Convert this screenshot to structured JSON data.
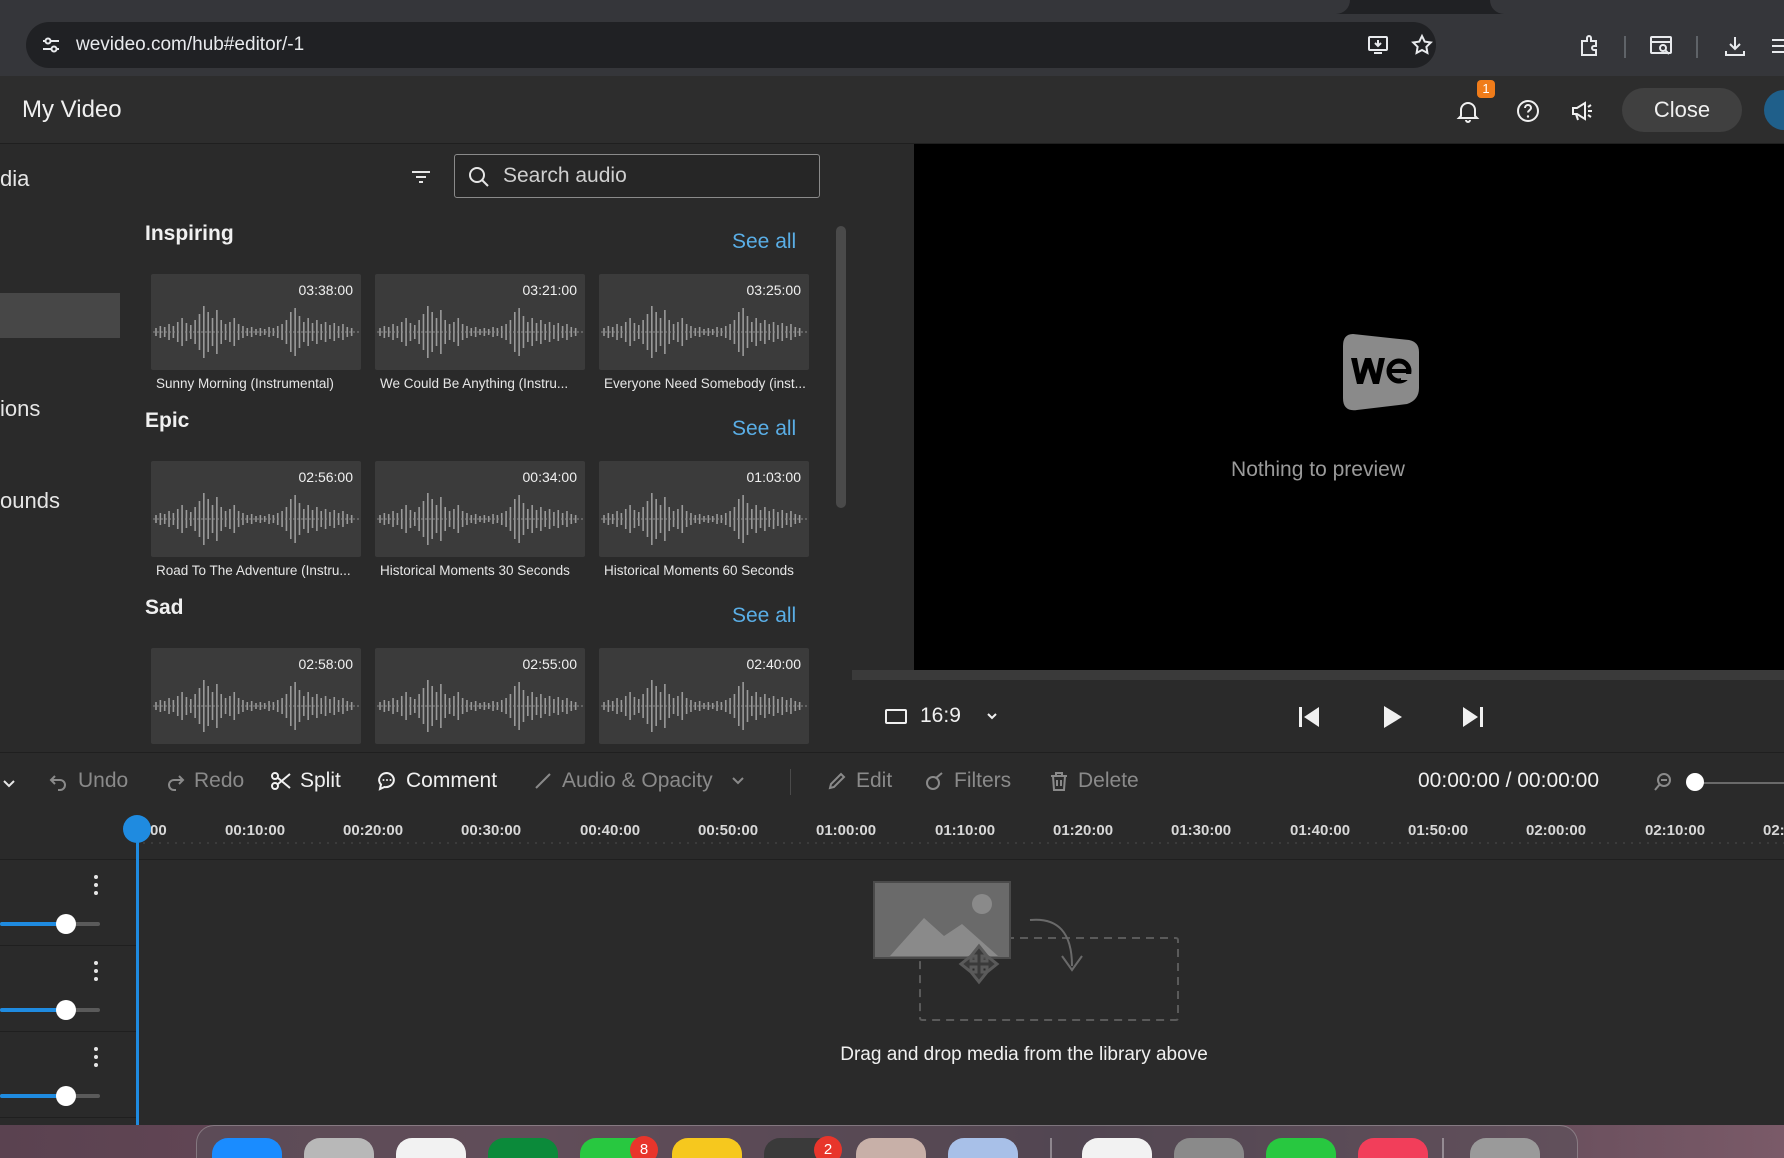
{
  "browser": {
    "url": "wevideo.com/hub#editor/-1"
  },
  "header": {
    "title": "My Video",
    "notification_count": "1",
    "close_label": "Close"
  },
  "leftnav": {
    "items": [
      {
        "label": "dia"
      },
      {
        "label": "ions"
      },
      {
        "label": "ounds"
      }
    ]
  },
  "library": {
    "search_placeholder": "Search audio",
    "sections": [
      {
        "title": "Inspiring",
        "see_all": "See all",
        "items": [
          {
            "duration": "03:38:00",
            "title": "Sunny Morning (Instrumental)"
          },
          {
            "duration": "03:21:00",
            "title": "We Could Be Anything (Instru..."
          },
          {
            "duration": "03:25:00",
            "title": "Everyone Need Somebody (inst..."
          }
        ]
      },
      {
        "title": "Epic",
        "see_all": "See all",
        "items": [
          {
            "duration": "02:56:00",
            "title": "Road To The Adventure (Instru..."
          },
          {
            "duration": "00:34:00",
            "title": "Historical Moments 30 Seconds"
          },
          {
            "duration": "01:03:00",
            "title": "Historical Moments 60 Seconds"
          }
        ]
      },
      {
        "title": "Sad",
        "see_all": "See all",
        "items": [
          {
            "duration": "02:58:00",
            "title": ""
          },
          {
            "duration": "02:55:00",
            "title": ""
          },
          {
            "duration": "02:40:00",
            "title": ""
          }
        ]
      }
    ]
  },
  "preview": {
    "empty_text": "Nothing to preview",
    "aspect_ratio": "16:9"
  },
  "toolbar": {
    "undo": "Undo",
    "redo": "Redo",
    "split": "Split",
    "comment": "Comment",
    "audio_opacity": "Audio & Opacity",
    "edit": "Edit",
    "filters": "Filters",
    "delete": "Delete",
    "timecode": "00:00:00 / 00:00:00"
  },
  "timeline": {
    "ticks": [
      "00",
      "00:10:00",
      "00:20:00",
      "00:30:00",
      "00:40:00",
      "00:50:00",
      "01:00:00",
      "01:10:00",
      "01:20:00",
      "01:30:00",
      "01:40:00",
      "01:50:00",
      "02:00:00",
      "02:10:00",
      "02:"
    ],
    "drop_hint": "Drag and drop media from the library above"
  },
  "dock": {
    "badges": [
      "8",
      "2"
    ]
  },
  "colors": {
    "accent": "#1f8be0",
    "link": "#5aaee6",
    "badge": "#f07c1a"
  }
}
